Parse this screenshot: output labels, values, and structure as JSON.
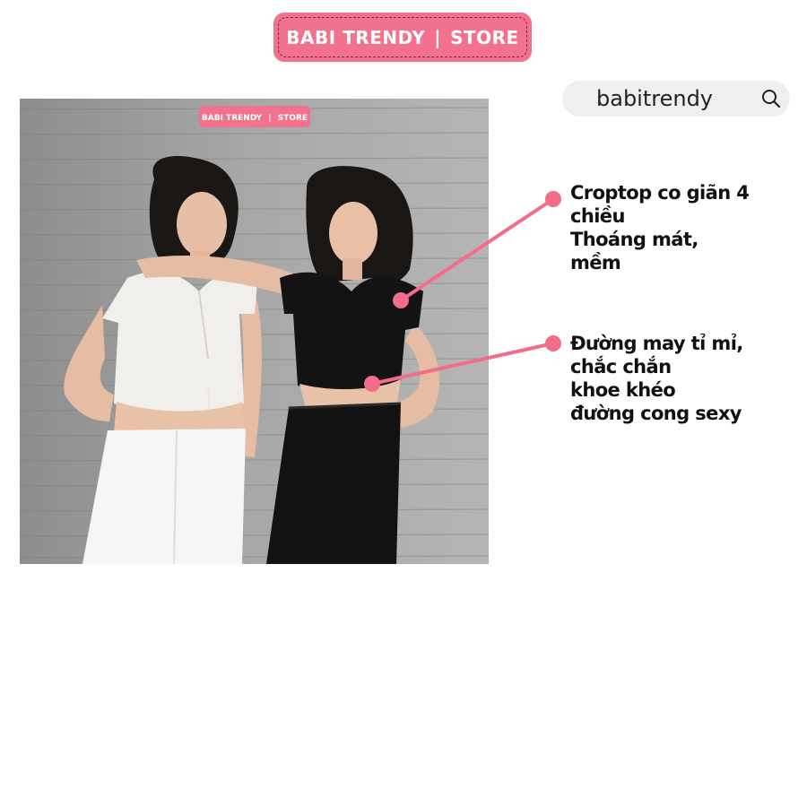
{
  "brand": {
    "name": "BABI TRENDY",
    "separator": "|",
    "suffix": "STORE"
  },
  "search": {
    "value": "babitrendy",
    "icon": "search-icon"
  },
  "photo": {
    "badge": {
      "name": "BABI TRENDY",
      "separator": "|",
      "suffix": "STORE"
    }
  },
  "callouts": [
    {
      "lines": [
        "Croptop co giãn 4",
        "chiều",
        "Thoáng mát,",
        "mềm"
      ]
    },
    {
      "lines": [
        "Đường may tỉ mỉ,",
        "chắc chắn",
        "khoe khéo",
        "đường cong sexy"
      ]
    }
  ],
  "colors": {
    "accent": "#f2718d",
    "connector": "#f26d8a",
    "search_bg": "#efefef"
  }
}
